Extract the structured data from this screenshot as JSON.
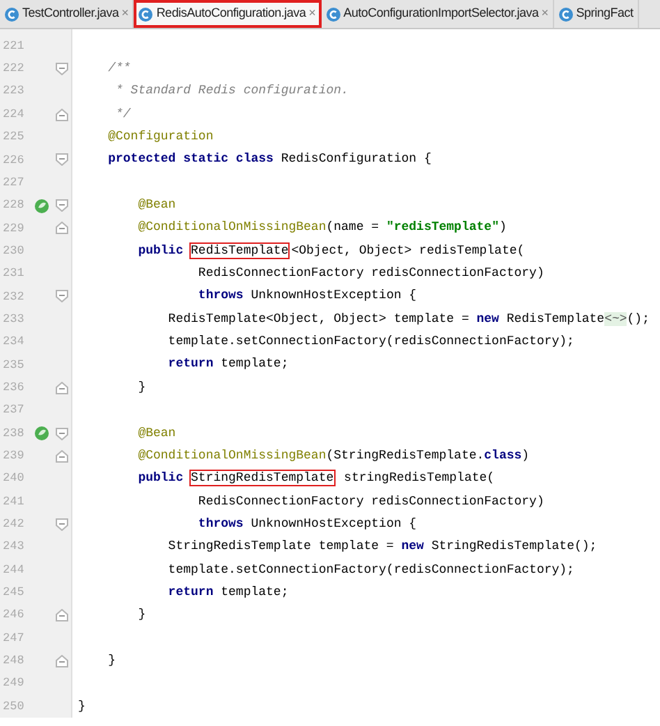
{
  "tabs": [
    {
      "label": "TestController.java",
      "close": "×",
      "selected": false
    },
    {
      "label": "RedisAutoConfiguration.java",
      "close": "×",
      "selected": true
    },
    {
      "label": "AutoConfigurationImportSelector.java",
      "close": "×",
      "selected": false
    },
    {
      "label": "SpringFact",
      "selected": false
    }
  ],
  "lines": [
    {
      "number": "221"
    },
    {
      "number": "222",
      "fold_start": true,
      "segments": [
        {
          "kind": "comment",
          "text": "    /**"
        }
      ]
    },
    {
      "number": "223",
      "segments": [
        {
          "kind": "comment",
          "text": "     * Standard Redis configuration."
        }
      ]
    },
    {
      "number": "224",
      "fold_end": true,
      "segments": [
        {
          "kind": "comment",
          "text": "     */"
        }
      ]
    },
    {
      "number": "225",
      "segments": [
        {
          "kind": "annotation",
          "text": "    @Configuration"
        }
      ]
    },
    {
      "number": "226",
      "fold_start": true,
      "segments": [
        {
          "kind": "keyword",
          "text": "    protected static class "
        },
        {
          "kind": "plain",
          "text": "RedisConfiguration {"
        }
      ]
    },
    {
      "number": "227"
    },
    {
      "number": "228",
      "fold_start": true,
      "bean_marker": true,
      "segments": [
        {
          "kind": "annotation",
          "text": "        @Bean"
        }
      ]
    },
    {
      "number": "229",
      "fold_end": true,
      "segments": [
        {
          "kind": "annotation",
          "text": "        @ConditionalOnMissingBean"
        },
        {
          "kind": "plain",
          "text": "(name = "
        },
        {
          "kind": "string",
          "text": "\"redisTemplate\""
        },
        {
          "kind": "plain",
          "text": ")"
        }
      ]
    },
    {
      "number": "230",
      "segments": [
        {
          "kind": "keyword",
          "text": "        public "
        },
        {
          "kind": "boxed",
          "text": "RedisTemplate"
        },
        {
          "kind": "plain",
          "text": "<Object, Object> redisTemplate("
        }
      ]
    },
    {
      "number": "231",
      "segments": [
        {
          "kind": "plain",
          "text": "                RedisConnectionFactory redisConnectionFactory)"
        }
      ]
    },
    {
      "number": "232",
      "fold_start": true,
      "segments": [
        {
          "kind": "keyword",
          "text": "                throws "
        },
        {
          "kind": "plain",
          "text": "UnknownHostException {"
        }
      ]
    },
    {
      "number": "233",
      "segments": [
        {
          "kind": "plain",
          "text": "            RedisTemplate<Object, Object> template = "
        },
        {
          "kind": "keyword",
          "text": "new "
        },
        {
          "kind": "plain",
          "text": "RedisTemplate"
        },
        {
          "kind": "hint",
          "text": "<~>"
        },
        {
          "kind": "plain",
          "text": "();"
        }
      ]
    },
    {
      "number": "234",
      "segments": [
        {
          "kind": "plain",
          "text": "            template.setConnectionFactory(redisConnectionFactory);"
        }
      ]
    },
    {
      "number": "235",
      "segments": [
        {
          "kind": "keyword",
          "text": "            return "
        },
        {
          "kind": "plain",
          "text": "template;"
        }
      ]
    },
    {
      "number": "236",
      "fold_end": true,
      "segments": [
        {
          "kind": "plain",
          "text": "        }"
        }
      ]
    },
    {
      "number": "237"
    },
    {
      "number": "238",
      "fold_start": true,
      "bean_marker": true,
      "segments": [
        {
          "kind": "annotation",
          "text": "        @Bean"
        }
      ]
    },
    {
      "number": "239",
      "fold_end": true,
      "segments": [
        {
          "kind": "annotation",
          "text": "        @ConditionalOnMissingBean"
        },
        {
          "kind": "plain",
          "text": "(StringRedisTemplate."
        },
        {
          "kind": "keyword",
          "text": "class"
        },
        {
          "kind": "plain",
          "text": ")"
        }
      ]
    },
    {
      "number": "240",
      "segments": [
        {
          "kind": "keyword",
          "text": "        public "
        },
        {
          "kind": "boxed",
          "text": "StringRedisTemplate"
        },
        {
          "kind": "plain",
          "text": " stringRedisTemplate("
        }
      ]
    },
    {
      "number": "241",
      "segments": [
        {
          "kind": "plain",
          "text": "                RedisConnectionFactory redisConnectionFactory)"
        }
      ]
    },
    {
      "number": "242",
      "fold_start": true,
      "segments": [
        {
          "kind": "keyword",
          "text": "                throws "
        },
        {
          "kind": "plain",
          "text": "UnknownHostException {"
        }
      ]
    },
    {
      "number": "243",
      "segments": [
        {
          "kind": "plain",
          "text": "            StringRedisTemplate template = "
        },
        {
          "kind": "keyword",
          "text": "new "
        },
        {
          "kind": "plain",
          "text": "StringRedisTemplate();"
        }
      ]
    },
    {
      "number": "244",
      "segments": [
        {
          "kind": "plain",
          "text": "            template.setConnectionFactory(redisConnectionFactory);"
        }
      ]
    },
    {
      "number": "245",
      "segments": [
        {
          "kind": "keyword",
          "text": "            return "
        },
        {
          "kind": "plain",
          "text": "template;"
        }
      ]
    },
    {
      "number": "246",
      "fold_end": true,
      "segments": [
        {
          "kind": "plain",
          "text": "        }"
        }
      ]
    },
    {
      "number": "247"
    },
    {
      "number": "248",
      "fold_end": true,
      "segments": [
        {
          "kind": "plain",
          "text": "    }"
        }
      ]
    },
    {
      "number": "249"
    },
    {
      "number": "250",
      "segments": [
        {
          "kind": "plain",
          "text": "}"
        }
      ]
    }
  ]
}
